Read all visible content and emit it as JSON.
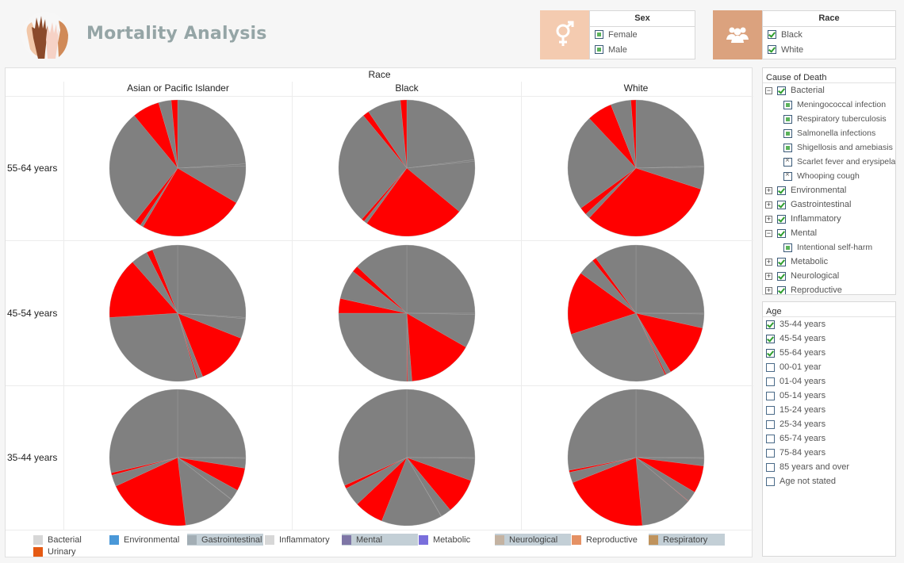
{
  "header": {
    "title": "Mortality Analysis",
    "logo_icon": "raised-hands-icon"
  },
  "filters": {
    "sex": {
      "title": "Sex",
      "icon": "gender-icon",
      "icon_bg": "#f4cbb0",
      "options": [
        {
          "label": "Female",
          "state": "partial"
        },
        {
          "label": "Male",
          "state": "partial"
        }
      ]
    },
    "race": {
      "title": "Race",
      "icon": "people-group-icon",
      "icon_bg": "#dba27e",
      "options": [
        {
          "label": "Black",
          "state": "checked"
        },
        {
          "label": "White",
          "state": "checked"
        }
      ]
    }
  },
  "cause_of_death": {
    "title": "Cause of Death",
    "items": [
      {
        "label": "Bacterial",
        "level": 0,
        "expander": "−",
        "state": "checked"
      },
      {
        "label": "Meningococcal infection",
        "level": 1,
        "state": "partial"
      },
      {
        "label": "Respiratory tuberculosis",
        "level": 1,
        "state": "partial"
      },
      {
        "label": "Salmonella infections",
        "level": 1,
        "state": "partial"
      },
      {
        "label": "Shigellosis and amebiasis",
        "level": 1,
        "state": "partial"
      },
      {
        "label": "Scarlet fever and erysipelas",
        "level": 1,
        "state": "excluded"
      },
      {
        "label": "Whooping cough",
        "level": 1,
        "state": "excluded"
      },
      {
        "label": "Environmental",
        "level": 0,
        "expander": "+",
        "state": "checked"
      },
      {
        "label": "Gastrointestinal",
        "level": 0,
        "expander": "+",
        "state": "checked"
      },
      {
        "label": "Inflammatory",
        "level": 0,
        "expander": "+",
        "state": "checked"
      },
      {
        "label": "Mental",
        "level": 0,
        "expander": "−",
        "state": "checked"
      },
      {
        "label": "Intentional self-harm",
        "level": 1,
        "state": "partial"
      },
      {
        "label": "Metabolic",
        "level": 0,
        "expander": "+",
        "state": "checked"
      },
      {
        "label": "Neurological",
        "level": 0,
        "expander": "+",
        "state": "checked"
      },
      {
        "label": "Reproductive",
        "level": 0,
        "expander": "+",
        "state": "checked"
      }
    ]
  },
  "age": {
    "title": "Age",
    "items": [
      {
        "label": "35-44 years",
        "checked": true
      },
      {
        "label": "45-54 years",
        "checked": true
      },
      {
        "label": "55-64 years",
        "checked": true
      },
      {
        "label": "00-01 year",
        "checked": false
      },
      {
        "label": "01-04 years",
        "checked": false
      },
      {
        "label": "05-14 years",
        "checked": false
      },
      {
        "label": "15-24 years",
        "checked": false
      },
      {
        "label": "25-34 years",
        "checked": false
      },
      {
        "label": "65-74 years",
        "checked": false
      },
      {
        "label": "75-84 years",
        "checked": false
      },
      {
        "label": "85 years and over",
        "checked": false
      },
      {
        "label": "Age not stated",
        "checked": false
      }
    ]
  },
  "chart_data": {
    "type": "pie",
    "title": "",
    "column_header": "Race",
    "columns": [
      "Asian or Pacific Islander",
      "Black",
      "White"
    ],
    "rows": [
      "55-64 years",
      "45-54 years",
      "35-44 years"
    ],
    "colors": {
      "highlighted": "#ff0000",
      "other": "#808080"
    },
    "note": "Slices listed clockwise from 12 o'clock as percent of pie; h=true means highlighted (red)",
    "pies": [
      [
        {
          "slices": [
            {
              "v": 24,
              "h": false
            },
            {
              "v": 0.5,
              "h": false
            },
            {
              "v": 9,
              "h": false
            },
            {
              "v": 25,
              "h": true
            },
            {
              "v": 0.7,
              "h": false
            },
            {
              "v": 1.5,
              "h": true
            },
            {
              "v": 28.3,
              "h": false
            },
            {
              "v": 6.5,
              "h": true
            },
            {
              "v": 3,
              "h": false
            },
            {
              "v": 1.5,
              "h": true
            }
          ]
        },
        {
          "slices": [
            {
              "v": 23,
              "h": false
            },
            {
              "v": 0.4,
              "h": false
            },
            {
              "v": 12.6,
              "h": false
            },
            {
              "v": 24,
              "h": true
            },
            {
              "v": 0.8,
              "h": false
            },
            {
              "v": 0.7,
              "h": true
            },
            {
              "v": 27.5,
              "h": false
            },
            {
              "v": 1.5,
              "h": true
            },
            {
              "v": 8,
              "h": false
            },
            {
              "v": 1.5,
              "h": true
            }
          ]
        },
        {
          "slices": [
            {
              "v": 24.5,
              "h": false
            },
            {
              "v": 0.3,
              "h": false
            },
            {
              "v": 5.2,
              "h": false
            },
            {
              "v": 32,
              "h": true
            },
            {
              "v": 1.2,
              "h": false
            },
            {
              "v": 1.8,
              "h": true
            },
            {
              "v": 23,
              "h": false
            },
            {
              "v": 6,
              "h": true
            },
            {
              "v": 4.8,
              "h": false
            },
            {
              "v": 1.2,
              "h": true
            }
          ]
        }
      ],
      [
        {
          "slices": [
            {
              "v": 26,
              "h": false
            },
            {
              "v": 0.3,
              "h": false
            },
            {
              "v": 4.7,
              "h": false
            },
            {
              "v": 13,
              "h": true
            },
            {
              "v": 1.3,
              "h": false
            },
            {
              "v": 0.3,
              "h": true
            },
            {
              "v": 28.4,
              "h": false
            },
            {
              "v": 14.5,
              "h": true
            },
            {
              "v": 4,
              "h": false
            },
            {
              "v": 1.5,
              "h": true
            },
            {
              "v": 6,
              "h": false
            }
          ]
        },
        {
          "slices": [
            {
              "v": 25,
              "h": false
            },
            {
              "v": 0.3,
              "h": false
            },
            {
              "v": 8,
              "h": false
            },
            {
              "v": 15.5,
              "h": true
            },
            {
              "v": 1,
              "h": false
            },
            {
              "v": 0.2,
              "h": true
            },
            {
              "v": 25,
              "h": false
            },
            {
              "v": 3.5,
              "h": true
            },
            {
              "v": 7,
              "h": false
            },
            {
              "v": 1.5,
              "h": true
            },
            {
              "v": 13,
              "h": false
            }
          ]
        },
        {
          "slices": [
            {
              "v": 25,
              "h": false
            },
            {
              "v": 0.2,
              "h": false
            },
            {
              "v": 3.3,
              "h": false
            },
            {
              "v": 13,
              "h": true
            },
            {
              "v": 1.2,
              "h": false
            },
            {
              "v": 0.3,
              "h": true
            },
            {
              "v": 27,
              "h": false
            },
            {
              "v": 15,
              "h": true
            },
            {
              "v": 4,
              "h": false
            },
            {
              "v": 1,
              "h": true
            },
            {
              "v": 10,
              "h": false
            }
          ]
        }
      ],
      [
        {
          "slices": [
            {
              "v": 25,
              "h": false
            },
            {
              "v": 0.2,
              "h": false
            },
            {
              "v": 2.3,
              "h": false
            },
            {
              "v": 5.5,
              "h": true
            },
            {
              "v": 2.5,
              "h": false
            },
            {
              "v": 0.1,
              "h": false
            },
            {
              "v": 12.5,
              "h": false
            },
            {
              "v": 20,
              "h": true
            },
            {
              "v": 2.7,
              "h": false
            },
            {
              "v": 0.6,
              "h": true
            },
            {
              "v": 28.6,
              "h": false
            }
          ]
        },
        {
          "slices": [
            {
              "v": 25,
              "h": false
            },
            {
              "v": 0.2,
              "h": false
            },
            {
              "v": 5.3,
              "h": false
            },
            {
              "v": 8.5,
              "h": true
            },
            {
              "v": 2.5,
              "h": false
            },
            {
              "v": 0.1,
              "h": false
            },
            {
              "v": 14.4,
              "h": false
            },
            {
              "v": 7,
              "h": true
            },
            {
              "v": 4.5,
              "h": false
            },
            {
              "v": 0.8,
              "h": true
            },
            {
              "v": 31.7,
              "h": false
            }
          ]
        },
        {
          "slices": [
            {
              "v": 25,
              "h": false
            },
            {
              "v": 0.2,
              "h": false
            },
            {
              "v": 1.8,
              "h": false
            },
            {
              "v": 6.5,
              "h": true
            },
            {
              "v": 2.5,
              "h": false
            },
            {
              "v": 0.1,
              "h": true
            },
            {
              "v": 12.4,
              "h": false
            },
            {
              "v": 20.5,
              "h": true
            },
            {
              "v": 2.5,
              "h": false
            },
            {
              "v": 0.5,
              "h": true
            },
            {
              "v": 28,
              "h": false
            }
          ]
        }
      ]
    ],
    "legend": [
      {
        "label": "Bacterial",
        "color": "#d7d7d7",
        "selected": false
      },
      {
        "label": "Environmental",
        "color": "#4a98d8",
        "selected": false
      },
      {
        "label": "Gastrointestinal",
        "color": "#a3aeb5",
        "selected": true
      },
      {
        "label": "Inflammatory",
        "color": "#d7d7d7",
        "selected": false
      },
      {
        "label": "Mental",
        "color": "#7e76a6",
        "selected": true
      },
      {
        "label": "Metabolic",
        "color": "#7a6fdc",
        "selected": false
      },
      {
        "label": "Neurological",
        "color": "#c4b3a2",
        "selected": true
      },
      {
        "label": "Reproductive",
        "color": "#e59164",
        "selected": false
      },
      {
        "label": "Respiratory",
        "color": "#bf935d",
        "selected": true
      },
      {
        "label": "Urinary",
        "color": "#e55a13",
        "selected": false
      }
    ]
  }
}
